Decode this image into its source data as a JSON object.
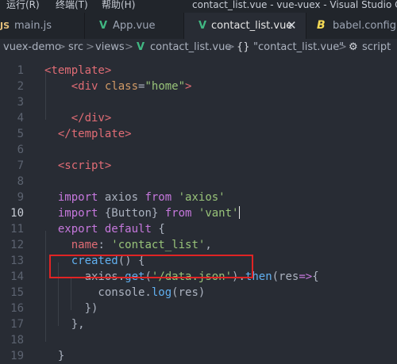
{
  "menubar": {
    "items": [
      "运行(R)",
      "终端(T)",
      "帮助(H)"
    ],
    "window_title": "contact_list.vue - vue-vuex - Visual Studio Code"
  },
  "tabs": [
    {
      "icon_text": "JS",
      "icon": "javascript-icon",
      "label": "main.js",
      "color": "#e5c07b"
    },
    {
      "icon_text": "V",
      "icon": "vue-icon",
      "label": "App.vue",
      "color": "#41b883"
    },
    {
      "icon_text": "V",
      "icon": "vue-icon",
      "label": "contact_list.vue",
      "close": "✕",
      "active": true,
      "color": "#41b883"
    },
    {
      "icon_text": "B",
      "icon": "babel-icon",
      "label": "babel.config.js",
      "color": "#f5da55"
    }
  ],
  "breadcrumb": {
    "items": [
      "vuex-demo",
      "src",
      "views",
      "contact_list.vue",
      "\"contact_list.vue\"",
      "script"
    ],
    "separator": ">",
    "braces": "{}",
    "script_icon": "⚙"
  },
  "editor": {
    "current_line": "10",
    "lines": [
      {
        "n": "1",
        "t": [
          [
            "tag",
            "<template>"
          ]
        ]
      },
      {
        "n": "2",
        "t": [
          [
            "plain",
            "    "
          ],
          [
            "tag",
            "<div"
          ],
          [
            "plain",
            " "
          ],
          [
            "attr",
            "class"
          ],
          [
            "plain",
            "="
          ],
          [
            "str",
            "\"home\""
          ],
          [
            "tag",
            ">"
          ]
        ]
      },
      {
        "n": "3",
        "t": []
      },
      {
        "n": "4",
        "t": [
          [
            "plain",
            "    "
          ],
          [
            "tag",
            "</div>"
          ]
        ]
      },
      {
        "n": "5",
        "t": [
          [
            "plain",
            "  "
          ],
          [
            "tag",
            "</template>"
          ]
        ]
      },
      {
        "n": "6",
        "t": []
      },
      {
        "n": "7",
        "t": [
          [
            "plain",
            "  "
          ],
          [
            "tag",
            "<script>"
          ]
        ]
      },
      {
        "n": "8",
        "t": []
      },
      {
        "n": "9",
        "t": [
          [
            "plain",
            "  "
          ],
          [
            "kw",
            "import"
          ],
          [
            "plain",
            " axios "
          ],
          [
            "kw",
            "from"
          ],
          [
            "plain",
            " "
          ],
          [
            "str",
            "'axios'"
          ]
        ]
      },
      {
        "n": "10",
        "t": [
          [
            "plain",
            "  "
          ],
          [
            "kw",
            "import"
          ],
          [
            "plain",
            " {Button} "
          ],
          [
            "kw",
            "from"
          ],
          [
            "plain",
            " "
          ],
          [
            "str",
            "'vant'"
          ]
        ]
      },
      {
        "n": "11",
        "t": [
          [
            "plain",
            "  "
          ],
          [
            "kw",
            "export"
          ],
          [
            "plain",
            " "
          ],
          [
            "kw",
            "default"
          ],
          [
            "plain",
            " {"
          ]
        ]
      },
      {
        "n": "12",
        "t": [
          [
            "plain",
            "    "
          ],
          [
            "prop",
            "name"
          ],
          [
            "plain",
            ": "
          ],
          [
            "str",
            "'contact_list'"
          ],
          [
            "plain",
            ","
          ]
        ]
      },
      {
        "n": "13",
        "t": [
          [
            "plain",
            "    "
          ],
          [
            "fn",
            "created"
          ],
          [
            "plain",
            "() {"
          ]
        ]
      },
      {
        "n": "14",
        "t": [
          [
            "plain",
            "      axios."
          ],
          [
            "fn",
            "get"
          ],
          [
            "plain",
            "("
          ],
          [
            "str",
            "'/data.json'"
          ],
          [
            "plain",
            ")."
          ],
          [
            "fn",
            "then"
          ],
          [
            "plain",
            "(res"
          ],
          [
            "kw",
            "=>"
          ],
          [
            "plain",
            "{"
          ]
        ]
      },
      {
        "n": "15",
        "t": [
          [
            "plain",
            "        console."
          ],
          [
            "fn",
            "log"
          ],
          [
            "plain",
            "(res)"
          ]
        ]
      },
      {
        "n": "16",
        "t": [
          [
            "plain",
            "      })"
          ]
        ]
      },
      {
        "n": "17",
        "t": [
          [
            "plain",
            "    },"
          ]
        ]
      },
      {
        "n": "18",
        "t": []
      },
      {
        "n": "19",
        "t": [
          [
            "plain",
            "  }"
          ]
        ]
      }
    ]
  }
}
